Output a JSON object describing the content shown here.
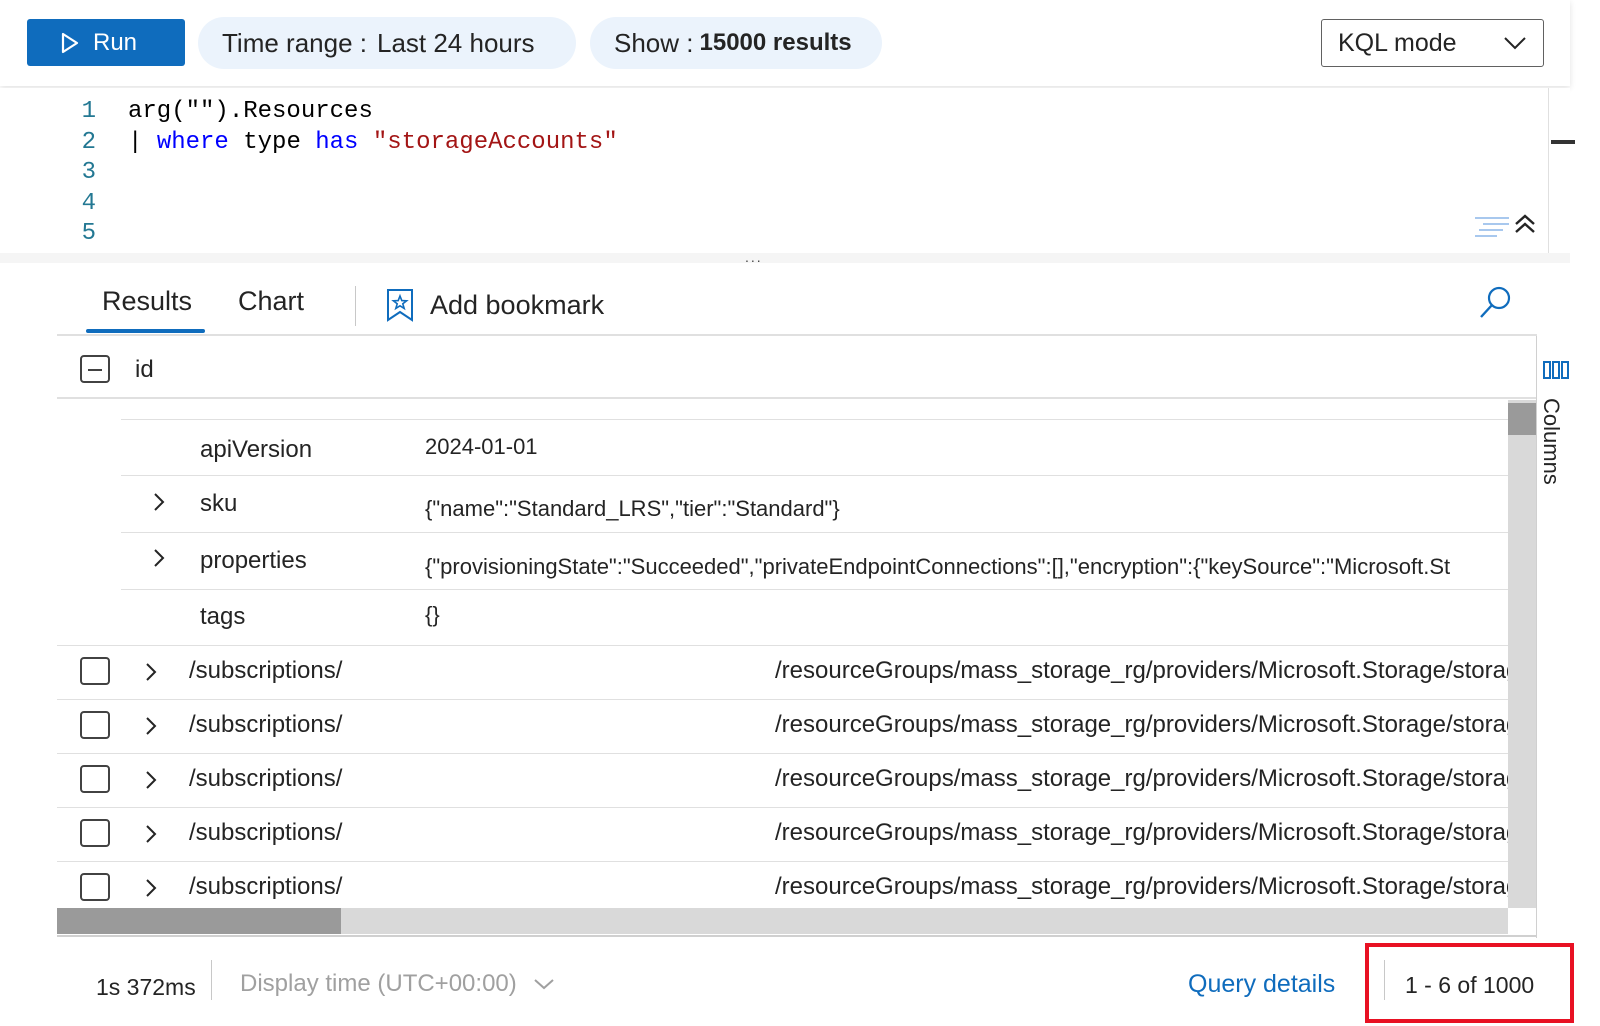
{
  "toolbar": {
    "run_label": "Run",
    "time_range_label": "Time range :",
    "time_range_value": "Last 24 hours",
    "show_label": "Show :",
    "show_value": "15000 results",
    "mode_value": "KQL mode"
  },
  "editor": {
    "line_numbers": [
      "1",
      "2",
      "3",
      "4",
      "5"
    ],
    "line1": "arg(\"\").Resources",
    "line2_pipe": "| ",
    "line2_where": "where",
    "line2_type": " type ",
    "line2_has": "has",
    "line2_space": " ",
    "line2_string": "\"storageAccounts\"",
    "splitter": "..."
  },
  "tabs": {
    "results": "Results",
    "chart": "Chart",
    "add_bookmark": "Add bookmark"
  },
  "grid": {
    "header_id": "id",
    "details": [
      {
        "key": "apiVersion",
        "value": "2024-01-01",
        "expandable": false
      },
      {
        "key": "sku",
        "value": "{\"name\":\"Standard_LRS\",\"tier\":\"Standard\"}",
        "expandable": true
      },
      {
        "key": "properties",
        "value": "{\"provisioningState\":\"Succeeded\",\"privateEndpointConnections\":[],\"encryption\":{\"keySource\":\"Microsoft.St",
        "expandable": true
      },
      {
        "key": "tags",
        "value": "{}",
        "expandable": false
      }
    ],
    "rows": [
      {
        "prefix": "/subscriptions/",
        "suffix": "/resourceGroups/mass_storage_rg/providers/Microsoft.Storage/storage"
      },
      {
        "prefix": "/subscriptions/",
        "suffix": "/resourceGroups/mass_storage_rg/providers/Microsoft.Storage/storage"
      },
      {
        "prefix": "/subscriptions/",
        "suffix": "/resourceGroups/mass_storage_rg/providers/Microsoft.Storage/storage"
      },
      {
        "prefix": "/subscriptions/",
        "suffix": "/resourceGroups/mass_storage_rg/providers/Microsoft.Storage/storage"
      },
      {
        "prefix": "/subscriptions/",
        "suffix": "/resourceGroups/mass_storage_rg/providers/Microsoft.Storage/storage"
      }
    ],
    "columns_label": "Columns"
  },
  "status": {
    "elapsed": "1s 372ms",
    "display_time": "Display time (UTC+00:00)",
    "query_details": "Query details",
    "pagination": "1 - 6 of 1000"
  },
  "colors": {
    "accent": "#0f6cbd",
    "pill_bg": "#ebf3fc",
    "highlight": "#e81123"
  }
}
